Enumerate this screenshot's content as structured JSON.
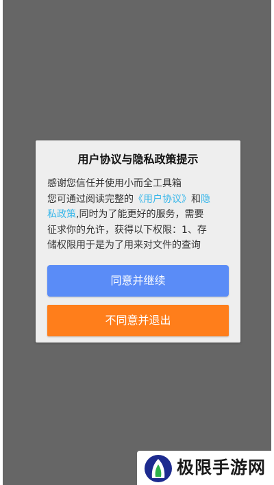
{
  "dialog": {
    "title": "用户协议与隐私政策提示",
    "body": {
      "line1": "感谢您信任并使用小而全工具箱",
      "line2_pre": "您可通过阅读完整的",
      "user_agreement_link": "《用户协议》",
      "line2_mid": "和",
      "privacy_link_part1": "隐",
      "privacy_link_part2": "私政策",
      "line3_rest": ",同时为了能更好的服务，需要",
      "line4": "征求你的允许，获得以下权限：1、存",
      "line5": "储权限用于是为了用来对文件的查询"
    },
    "agree_button": "同意并继续",
    "disagree_button": "不同意并退出"
  },
  "watermark": {
    "text": "极限手游网"
  },
  "colors": {
    "overlay": "#666666",
    "dialog_bg": "#eeeeee",
    "link": "#35b6ea",
    "agree": "#5a8cf7",
    "disagree": "#ff7e1b"
  }
}
